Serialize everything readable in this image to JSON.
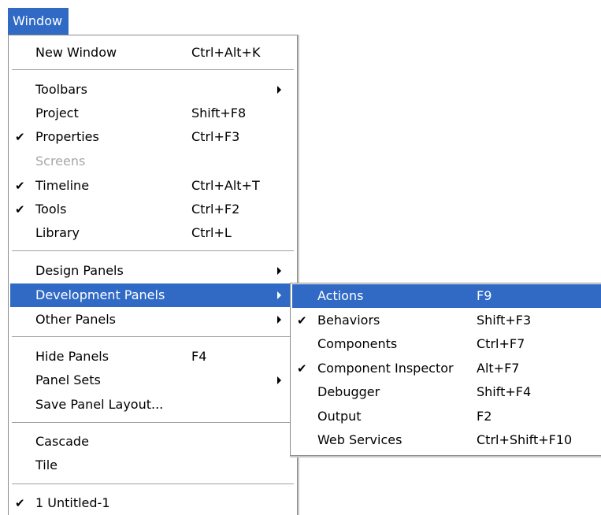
{
  "menubar": {
    "title": "Window"
  },
  "window_menu": {
    "items": [
      {
        "label": "New Window",
        "shortcut": "Ctrl+Alt+K"
      },
      {
        "label": "Toolbars"
      },
      {
        "label": "Project",
        "shortcut": "Shift+F8"
      },
      {
        "label": "Properties",
        "shortcut": "Ctrl+F3",
        "checked": true
      },
      {
        "label": "Screens",
        "disabled": true
      },
      {
        "label": "Timeline",
        "shortcut": "Ctrl+Alt+T",
        "checked": true
      },
      {
        "label": "Tools",
        "shortcut": "Ctrl+F2",
        "checked": true
      },
      {
        "label": "Library",
        "shortcut": "Ctrl+L"
      },
      {
        "label": "Design Panels"
      },
      {
        "label": "Development Panels",
        "highlighted": true
      },
      {
        "label": "Other Panels"
      },
      {
        "label": "Hide Panels",
        "shortcut": "F4"
      },
      {
        "label": "Panel Sets"
      },
      {
        "label": "Save Panel Layout..."
      },
      {
        "label": "Cascade"
      },
      {
        "label": "Tile"
      },
      {
        "label": "1 Untitled-1",
        "checked": true
      }
    ]
  },
  "development_panels_submenu": {
    "items": [
      {
        "label": "Actions",
        "shortcut": "F9",
        "highlighted": true
      },
      {
        "label": "Behaviors",
        "shortcut": "Shift+F3",
        "checked": true
      },
      {
        "label": "Components",
        "shortcut": "Ctrl+F7"
      },
      {
        "label": "Component Inspector",
        "shortcut": "Alt+F7",
        "checked": true
      },
      {
        "label": "Debugger",
        "shortcut": "Shift+F4"
      },
      {
        "label": "Output",
        "shortcut": "F2"
      },
      {
        "label": "Web Services",
        "shortcut": "Ctrl+Shift+F10"
      }
    ]
  },
  "icons": {
    "check": "checkmark-icon",
    "submenu": "submenu-arrow-icon"
  },
  "colors": {
    "highlight": "#316ac5",
    "disabled_text": "#a6a6a6"
  }
}
